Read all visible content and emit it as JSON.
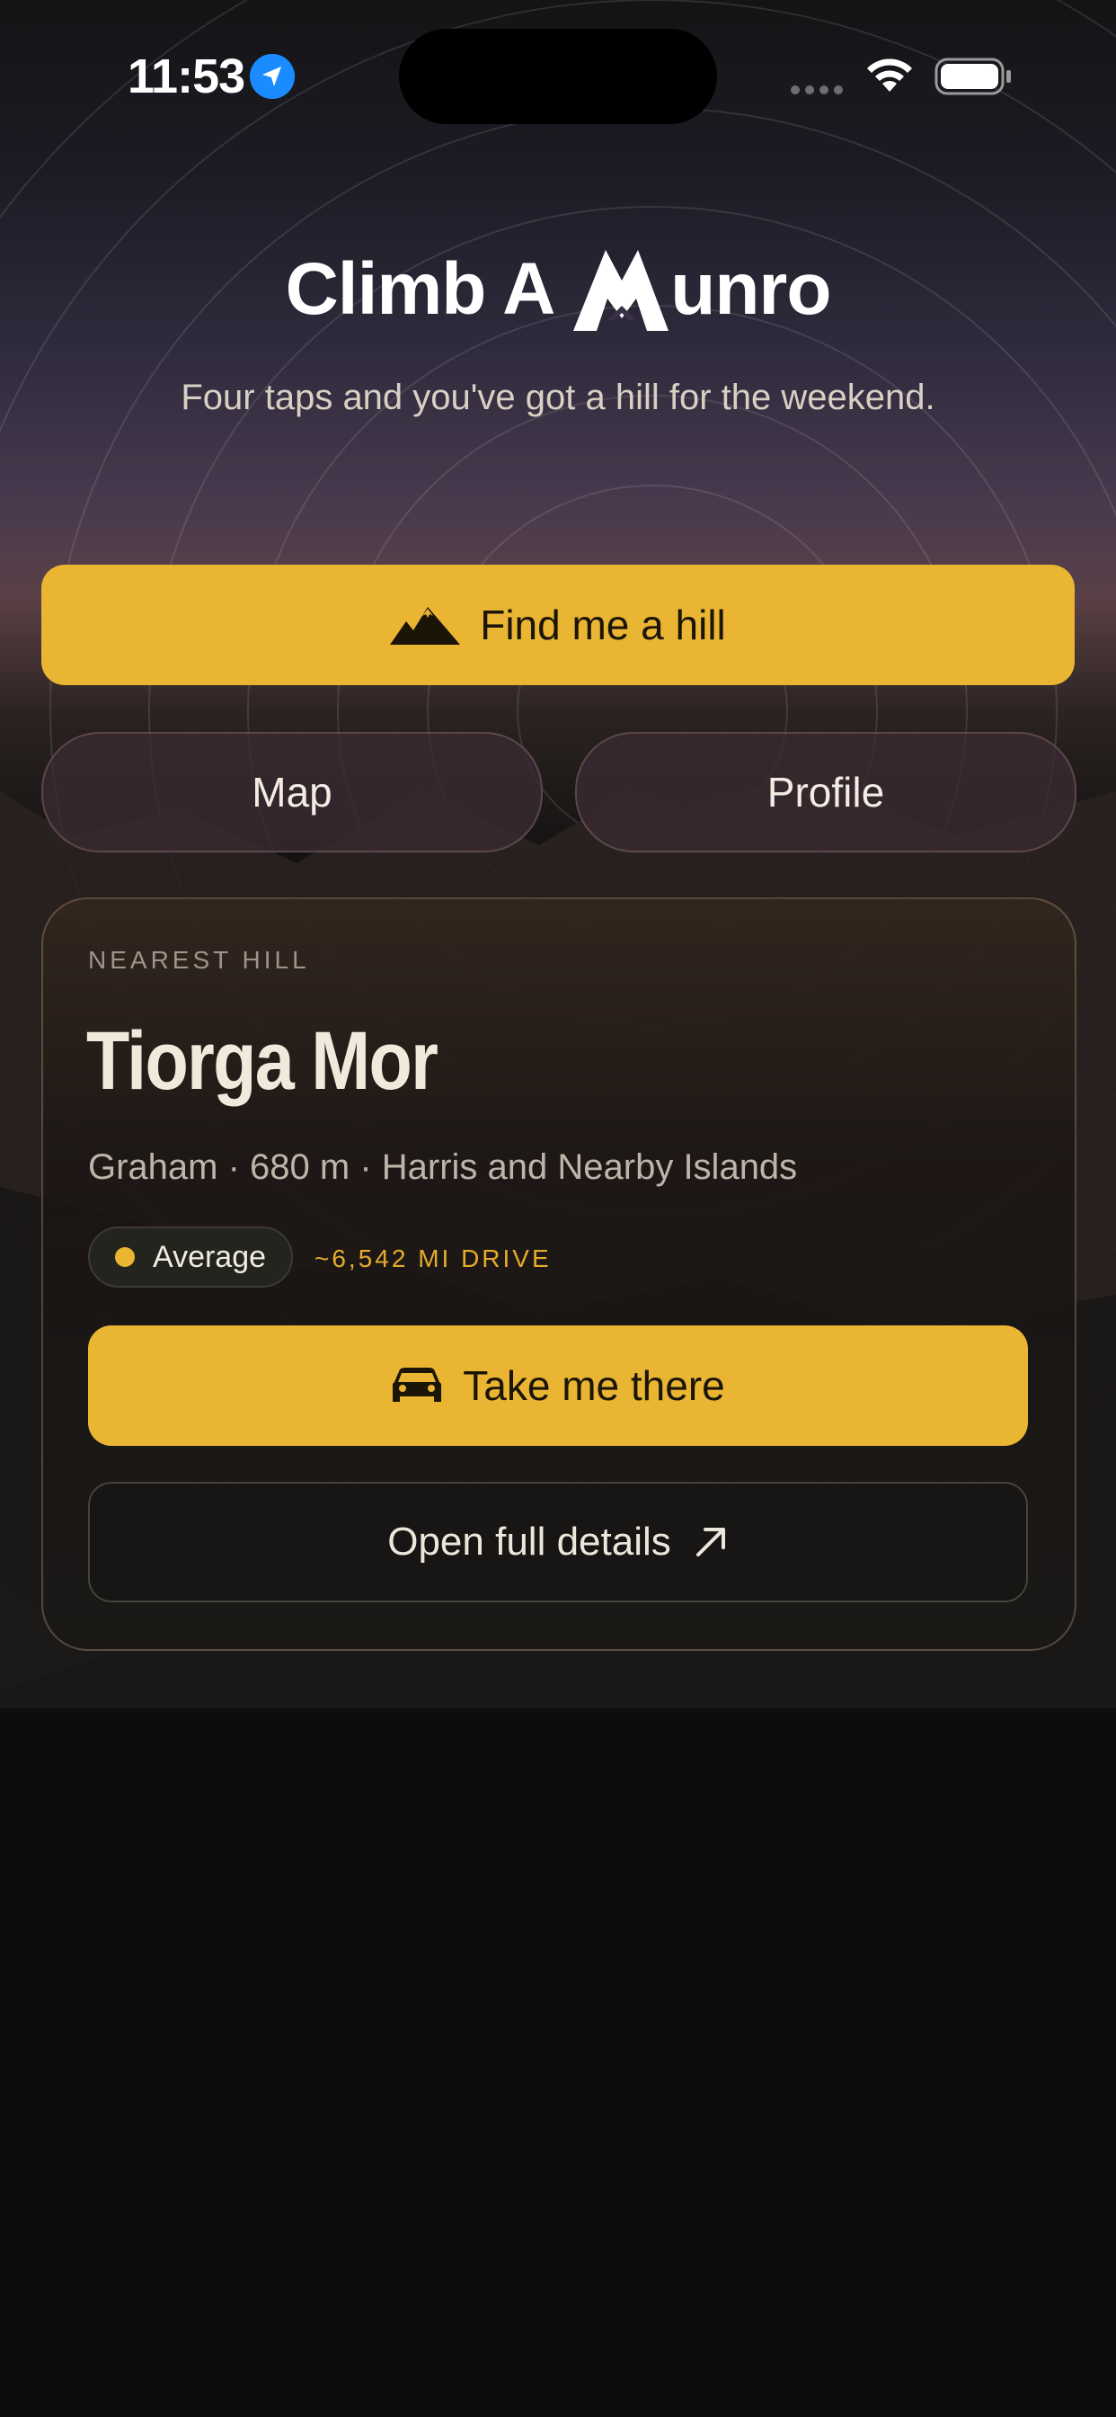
{
  "status_bar": {
    "time": "11:53",
    "icons": [
      "location-arrow-icon",
      "cellular-signal-icon",
      "wifi-icon",
      "battery-icon"
    ]
  },
  "header": {
    "logo_text_left": "Climb A",
    "logo_text_right": "unro",
    "tagline": "Four taps and you've got a hill for the weekend."
  },
  "actions": {
    "find_label": "Find me a hill",
    "find_icon": "mountains-icon",
    "map_label": "Map",
    "profile_label": "Profile"
  },
  "nearest": {
    "eyebrow": "NEAREST HILL",
    "name": "Tiorga Mor",
    "meta": "Graham · 680 m · Harris and Nearby Islands",
    "difficulty": "Average",
    "drive": "~6,542 MI DRIVE",
    "take_label": "Take me there",
    "take_icon": "car-icon",
    "details_label": "Open full details",
    "details_icon": "external-arrow-icon"
  },
  "colors": {
    "accent": "#eab532",
    "background": "#0d0d0d",
    "text": "#ece6dc"
  }
}
